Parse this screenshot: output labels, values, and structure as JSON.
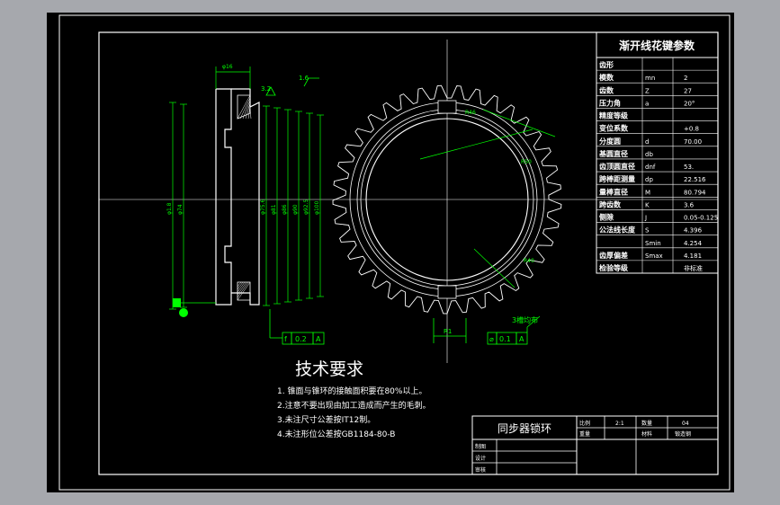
{
  "param_table": {
    "title": "渐开线花键参数",
    "rows": [
      {
        "name": "齿形",
        "symbol": "",
        "value": ""
      },
      {
        "name": "模数",
        "symbol": "mn",
        "value": "2"
      },
      {
        "name": "齿数",
        "symbol": "Z",
        "value": "27"
      },
      {
        "name": "压力角",
        "symbol": "a",
        "value": "20°"
      },
      {
        "name": "精度等级",
        "symbol": "",
        "value": ""
      },
      {
        "name": "变位系数",
        "symbol": "",
        "value": "+0.8"
      },
      {
        "name": "分度圆",
        "symbol": "d",
        "value": "70.00"
      },
      {
        "name": "基圆直径",
        "symbol": "db",
        "value": ""
      },
      {
        "name": "齿顶圆直径",
        "symbol": "dnf",
        "value": "53."
      },
      {
        "name": "跨棒距测量",
        "symbol": "dp",
        "value": "22.516"
      },
      {
        "name": "量棒直径",
        "symbol": "M",
        "value": "80.794"
      },
      {
        "name": "跨齿数",
        "symbol": "K",
        "value": "3.6"
      },
      {
        "name": "侧隙",
        "symbol": "J",
        "value": "0.05-0.125"
      },
      {
        "name": "公法线长度",
        "symbol": "S",
        "value": "4.396"
      },
      {
        "name": "",
        "symbol": "Smin",
        "value": "4.254"
      },
      {
        "name": "齿厚偏差",
        "symbol": "Smax",
        "value": "4.181"
      },
      {
        "name": "检验等级",
        "symbol": "",
        "value": "非标准"
      }
    ]
  },
  "tech_requirements": {
    "title": "技术要求",
    "items": [
      "1. 锥面与锥环的接触面积要在80%以上。",
      "2.注意不要出现由加工造成而产生的毛刺。",
      "3.未注尺寸公差按IT12制。",
      "4.未注形位公差按GB1184-80-B"
    ]
  },
  "title_block": {
    "part_name": "同步器锁环",
    "labels": {
      "scale": "比例",
      "scale_value": "2:1",
      "material": "材料",
      "material_value": "04",
      "sheet": "数量",
      "weight": "重量",
      "designer": "制图",
      "design": "设计",
      "review": "审核",
      "school": "锻造钢"
    },
    "rows": [
      "制图",
      "设计",
      "审核"
    ]
  },
  "section_view": {
    "dims": [
      "φ16",
      "φ1.8",
      "φ74",
      "φ75.6",
      "φ81",
      "φ86",
      "φ90",
      "φ92.5",
      "φ100"
    ],
    "roughness": [
      "3.2",
      "1.6"
    ],
    "tolerance_frame": [
      "f",
      "0.2",
      "A"
    ]
  },
  "gear_view": {
    "labels": [
      "R1",
      "R46",
      "R50",
      "R40",
      "3槽均布"
    ],
    "tolerance_frame": [
      "⌀",
      "0.1",
      "A"
    ],
    "tooth_count": 27
  },
  "colors": {
    "background": "#000000",
    "outline": "#ffffff",
    "dims": "#00ff00",
    "frame_margin": "#a6a8ad"
  }
}
